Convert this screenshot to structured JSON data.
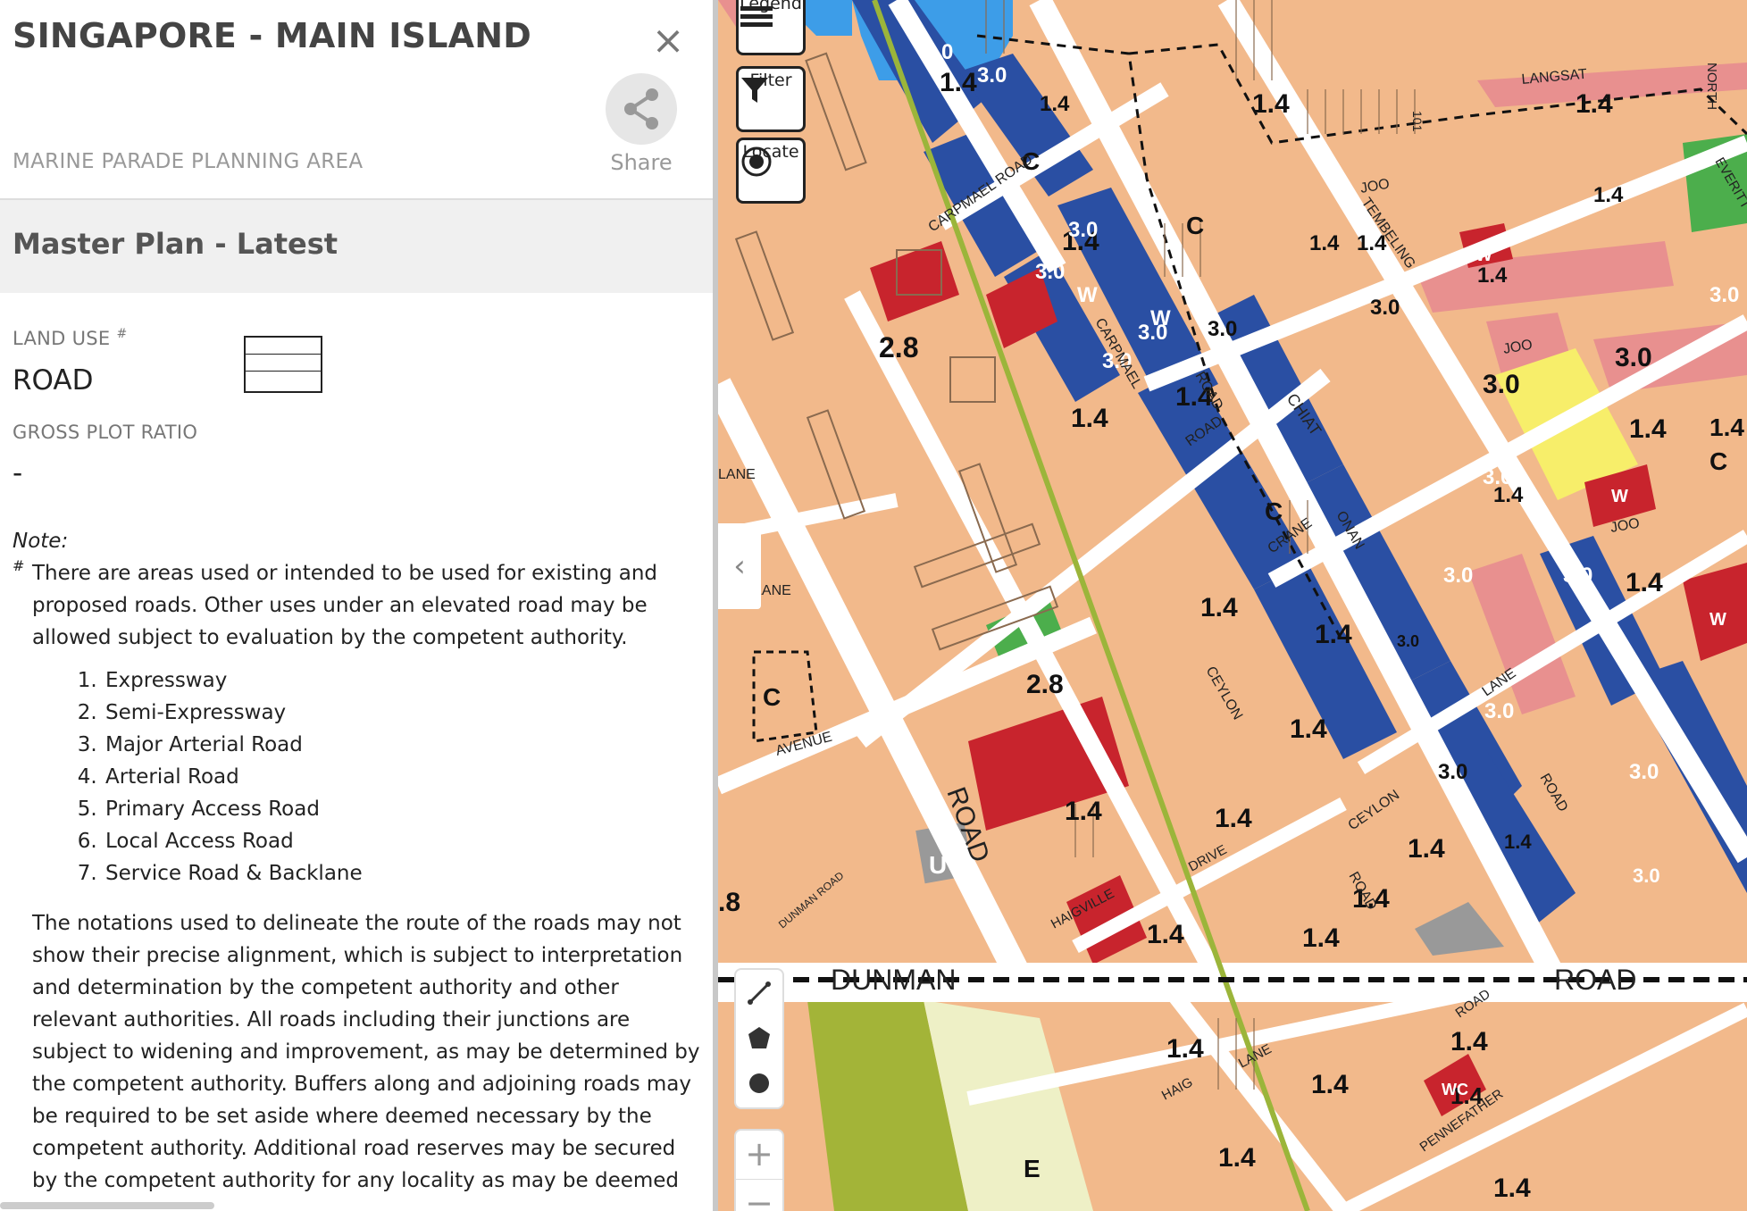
{
  "panel": {
    "title": "SINGAPORE - MAIN ISLAND",
    "close_symbol": "×",
    "planning_area": "MARINE PARADE PLANNING AREA",
    "share_label": "Share",
    "share_icon": "share-icon",
    "plan_title": "Master Plan - Latest",
    "land_use_label": "LAND USE",
    "land_use_marker": "#",
    "land_use_value": "ROAD",
    "gpr_label": "GROSS PLOT RATIO",
    "gpr_value": "-",
    "note_label": "Note:",
    "note_marker": "#",
    "note_text": "There are areas used or intended to be used for existing and proposed roads. Other uses under an elevated road may be allowed subject to evaluation by the competent authority.",
    "road_types": [
      "Expressway",
      "Semi-Expressway",
      "Major Arterial Road",
      "Arterial Road",
      "Primary Access Road",
      "Local Access Road",
      "Service Road & Backlane"
    ],
    "note_text_2": "The notations used to delineate the route of the roads may not show their precise alignment, which is subject to interpretation and determination by the competent authority and other relevant authorities. All roads including their junctions are subject to widening and improvement, as may be determined by the competent authority. Buffers along and adjoining roads may be required to be set aside where deemed necessary by the competent authority. Additional road reserves may be secured by the competent authority for any locality as may be deemed"
  },
  "map_controls": {
    "legend_label": "Legend",
    "filter_label": "Filter",
    "locate_label": "Locate",
    "collapse_symbol": "‹",
    "zoom_in": "+",
    "zoom_out": "−"
  },
  "map_labels": {
    "plot_ratios": [
      "1.4",
      "3.0",
      "2.8",
      "W",
      "C",
      "U",
      "E"
    ],
    "street_names": [
      "DUNMAN",
      "ROAD",
      "CARPMAEL",
      "LANGSAT",
      "JOO",
      "CHIAT",
      "CEYLON",
      "CRANE",
      "HAIG",
      "LANE",
      "AVENUE",
      "DRIVE",
      "HAIGVILLE",
      "ONAN",
      "PENNEFATHER",
      "EVERITT",
      "TEMBELING",
      "NORTH",
      "101",
      "DUNMAN ROAD"
    ]
  },
  "colors": {
    "residential": "#f2b98b",
    "commercial_blue": "#2a4fa3",
    "water_blue": "#3d9de8",
    "commercial_red": "#c8242d",
    "pink": "#e8908f",
    "yellow": "#f7ee6a",
    "green": "#4cae4c",
    "olive": "#a3b438",
    "pale": "#eef0c6",
    "road": "#ffffff"
  }
}
